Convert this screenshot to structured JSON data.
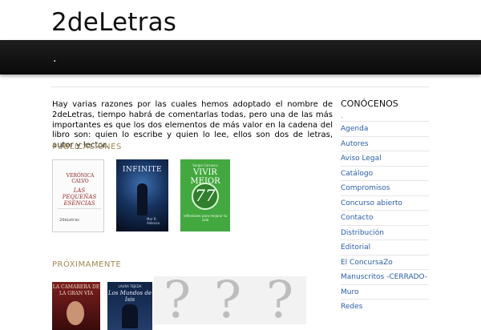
{
  "site": {
    "title": "2deLetras"
  },
  "nav": {
    "item": "."
  },
  "intro": "Hay varias razones por las cuales hemos adoptado el nombre de 2deLetras, tiempo habrá de comentarlas todas, pero una de las más importantes es que los dos elementos de más valor en la cadena del libro son: quien lo escribe y quien lo lee, ellos son dos de letras, autor y lector.",
  "publicaciones": {
    "title": "PUBLICACIONES",
    "books": [
      {
        "author": "VERÓNICA CALVO",
        "title": "LAS PEQUEÑAS ESENCIAS",
        "publisher": "2deLetras"
      },
      {
        "title": "INFINITE",
        "author": "Mar R. Aldecoa"
      },
      {
        "author": "Sergio Carrasco",
        "title": "VIVIR MEJOR",
        "number": "77",
        "subtitle": "reflexiones para mejorar tu vida"
      }
    ]
  },
  "proximamente": {
    "title": "PRÓXIMAMENTE",
    "books": [
      {
        "title": "LA CAMARERA DE LA GRAN VÍA"
      },
      {
        "author": "LAURA TEJEDA",
        "title": "Los Mundos de Isis"
      }
    ],
    "placeholders": [
      "?",
      "?",
      "?"
    ]
  },
  "sidebar": {
    "title": "CONÓCENOS",
    "dot": ".",
    "items": [
      "Agenda",
      "Autores",
      "Aviso Legal",
      "Catálogo",
      "Compromisos",
      "Concurso abierto",
      "Contacto",
      "Distribución",
      "Editorial",
      "El ConcursaZo",
      "Manuscritos -CERRADO-",
      "Muro",
      "Redes"
    ]
  }
}
